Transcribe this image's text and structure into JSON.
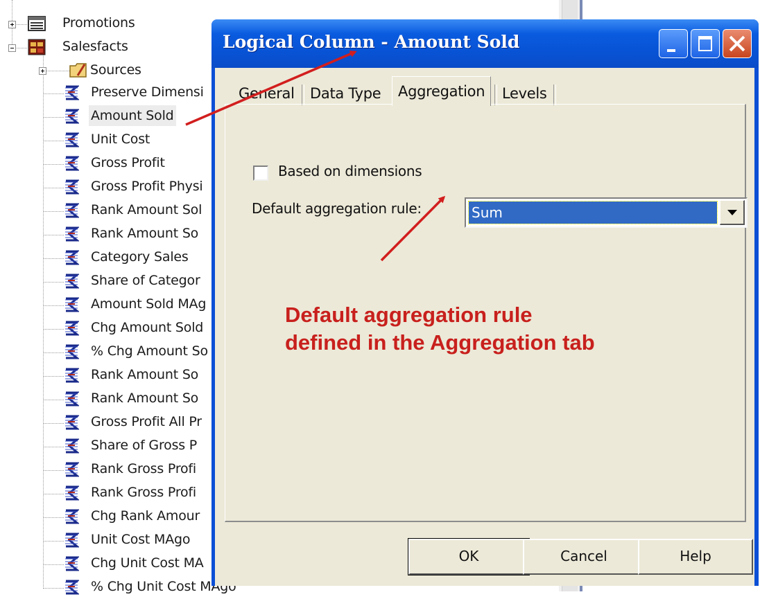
{
  "tree": {
    "parents": [
      {
        "label": "Promotions",
        "icon": "table-icon",
        "expanded": false
      },
      {
        "label": "Salesfacts",
        "icon": "fact-table-icon",
        "expanded": true
      },
      {
        "label": "Sources",
        "icon": "folder-icon",
        "expanded": false
      }
    ],
    "columns": [
      "Preserve Dimensi",
      "Amount Sold",
      "Unit Cost",
      "Gross Profit",
      "Gross Profit Physi",
      "Rank Amount Sol",
      "Rank Amount So",
      "Category Sales",
      "Share of Categor",
      "Amount Sold MAg",
      "Chg Amount Sold",
      "% Chg Amount So",
      "Rank Amount So",
      "Rank Amount So",
      "Gross Profit All Pr",
      "Share of Gross P",
      "Rank Gross Profi",
      "Rank Gross Profi",
      "Chg Rank Amour",
      "Unit Cost MAgo",
      "Chg Unit Cost MA",
      "% Chg Unit Cost MAgo"
    ],
    "selected": "Amount Sold"
  },
  "dialog": {
    "title": "Logical Column - Amount Sold",
    "tabs": [
      "General",
      "Data Type",
      "Aggregation",
      "Levels"
    ],
    "active_tab": "Aggregation",
    "based_on_dimensions_label": "Based on dimensions",
    "based_on_dimensions_checked": false,
    "default_rule_label": "Default aggregation rule:",
    "default_rule_value": "Sum",
    "buttons": {
      "ok": "OK",
      "cancel": "Cancel",
      "help": "Help"
    }
  },
  "annotation": {
    "line1": "Default aggregation rule",
    "line2": "defined in the Aggregation tab",
    "color": "#c8201d"
  },
  "colors": {
    "titlebar": "#0a5bdf",
    "dialog_face": "#ece9d8",
    "selection": "#316ac5"
  }
}
